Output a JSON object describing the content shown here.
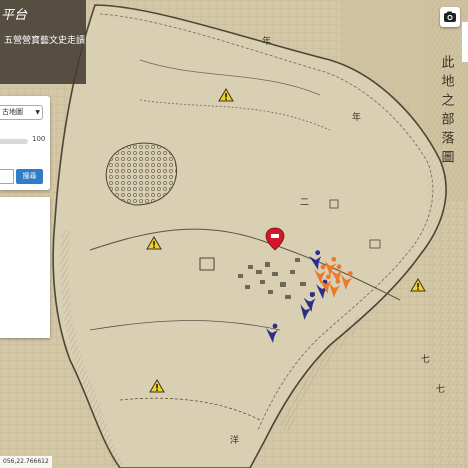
{
  "header": {
    "brand": "平台",
    "subtitle": "五營營寶藝文史走讀"
  },
  "panel": {
    "layer_select": "古地圖",
    "opacity_value": "100",
    "search_button": "搜尋"
  },
  "map": {
    "handwritten_labels": [
      "年",
      "年",
      "二",
      "七",
      "七",
      "洋"
    ],
    "margin_note": "此地之部落圖",
    "colors": {
      "warning": "#f4d21e",
      "person_blue": "#2b2f8c",
      "person_orange": "#ea7b2c",
      "temple_red": "#d0182a"
    }
  },
  "status": {
    "coordinates": "056,22.766612"
  }
}
